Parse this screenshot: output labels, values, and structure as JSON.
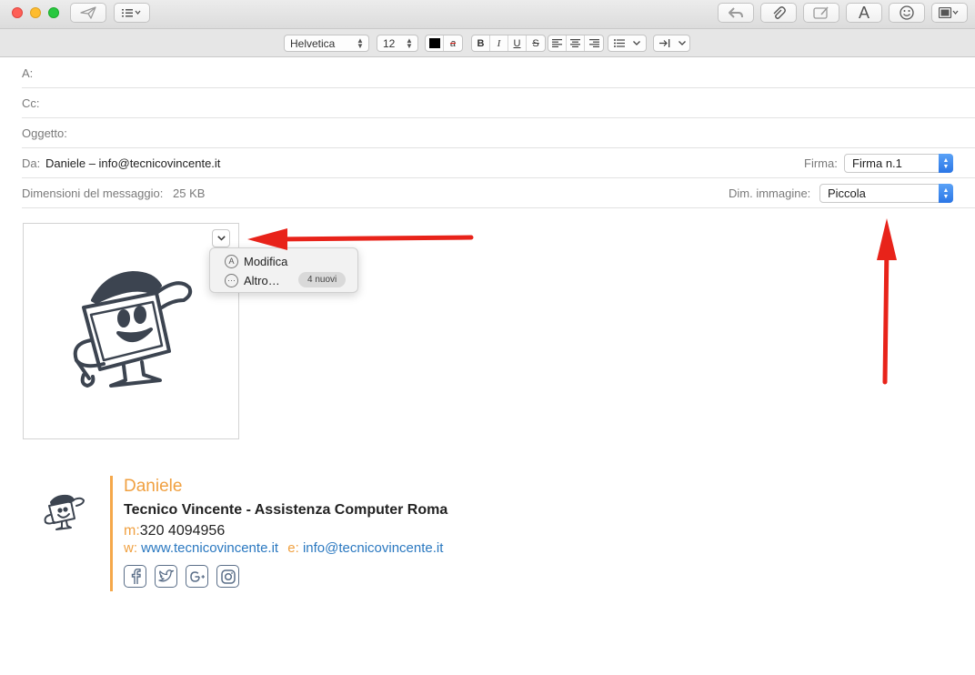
{
  "toolbar": {
    "send_icon": "send-icon",
    "header_fields_icon": "list-icon",
    "reply_icon": "reply-icon",
    "attach_icon": "paperclip-icon",
    "markup_icon": "markup-icon",
    "fonts_label": "A",
    "emoji_icon": "smiley-icon",
    "photo_icon": "photo-browser-icon"
  },
  "format_bar": {
    "font_family": "Helvetica",
    "font_size": "12",
    "text_color": "#000000",
    "bold": "B",
    "italic": "I",
    "underline": "U",
    "strikethrough": "S"
  },
  "header": {
    "to_label": "A:",
    "cc_label": "Cc:",
    "subject_label": "Oggetto:",
    "from_label": "Da:",
    "from_value": "Daniele – info@tecnicovincente.it",
    "signature_label": "Firma:",
    "signature_value": "Firma n.1",
    "size_label": "Dimensioni del messaggio:",
    "size_value": "25 KB",
    "image_size_label": "Dim. immagine:",
    "image_size_value": "Piccola"
  },
  "image_menu": {
    "edit_label": "Modifica",
    "more_label": "Altro…",
    "new_badge": "4 nuovi"
  },
  "signature": {
    "name": "Daniele",
    "company": "Tecnico Vincente - Assistenza Computer Roma",
    "mobile_key": "m:",
    "mobile_value": "320 4094956",
    "web_key": "w:",
    "web_value": "www.tecnicovincente.it",
    "email_key": "e:",
    "email_value": "info@tecnicovincente.it",
    "social_icons": [
      "facebook-icon",
      "twitter-icon",
      "google-plus-icon",
      "instagram-icon"
    ]
  },
  "colors": {
    "accent_orange": "#f0a040",
    "link_blue": "#2a78c0",
    "annotation_red": "#e8231a"
  }
}
